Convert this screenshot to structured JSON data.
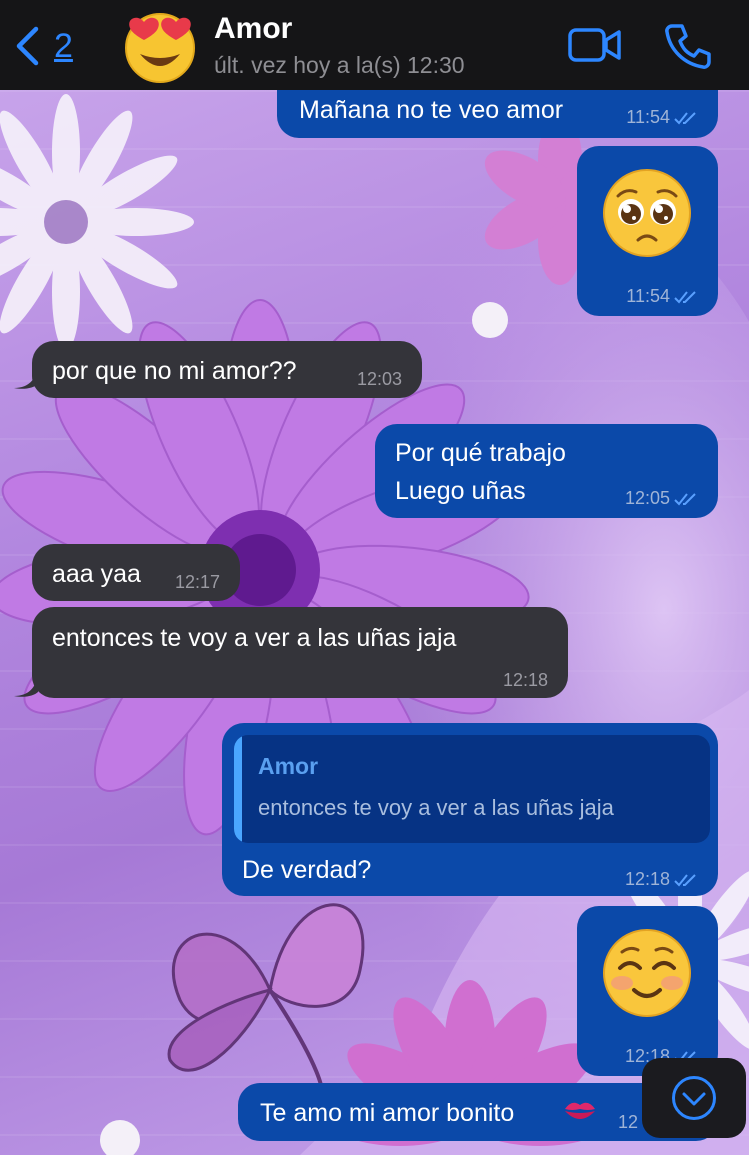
{
  "header": {
    "back_count": "2",
    "contact_name": "Amor",
    "status": "últ. vez hoy a la(s) 12:30",
    "avatar_icon": "heart-eyes-emoji-icon",
    "video_icon": "video-call-icon",
    "call_icon": "phone-icon"
  },
  "messages": [
    {
      "direction": "out",
      "text": "Mañana no te veo amor",
      "time": "11:54",
      "status": "read"
    },
    {
      "direction": "out",
      "emoji": "pleading-face-emoji",
      "time": "11:54",
      "status": "read"
    },
    {
      "direction": "in",
      "text": "por que no mi amor??",
      "time": "12:03"
    },
    {
      "direction": "out",
      "lines": [
        "Por qué trabajo",
        "Luego uñas"
      ],
      "time": "12:05",
      "status": "read"
    },
    {
      "direction": "in",
      "text": "aaa yaa",
      "time": "12:17"
    },
    {
      "direction": "in",
      "text": "entonces te voy a ver a las uñas jaja",
      "time": "12:18"
    },
    {
      "direction": "out",
      "reply_to": {
        "name": "Amor",
        "text": "entonces te voy a ver a las uñas jaja"
      },
      "text": "De verdad?",
      "time": "12:18",
      "status": "read"
    },
    {
      "direction": "out",
      "emoji": "smiling-face-emoji",
      "time": "12:18",
      "status": "read"
    },
    {
      "direction": "out",
      "text": "Te amo mi amor bonito",
      "trailing_emoji": "kiss-mark-emoji",
      "time": "12",
      "status": "read"
    }
  ],
  "scroll_down_icon": "chevron-down-circle-icon",
  "colors": {
    "header_bg": "#151517",
    "accent": "#2d86ff",
    "outgoing_bubble": "#0b49a9",
    "incoming_bubble": "#34343a",
    "read_ticks": "#5aa0ff",
    "wallpaper": "#b58be0"
  }
}
